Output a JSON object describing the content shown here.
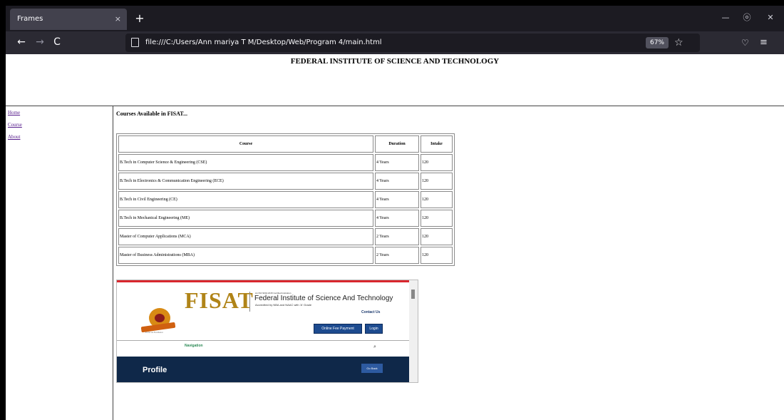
{
  "browser": {
    "tab_title": "Frames",
    "tab_close": "×",
    "new_tab": "+",
    "back": "←",
    "forward": "→",
    "reload": "C",
    "url": "file:///C:/Users/Ann mariya T M/Desktop/Web/Program 4/main.html",
    "zoom": "67%",
    "bookmark_star": "☆",
    "pocket": "♡",
    "menu": "≡",
    "minimize": "—",
    "restore": "ⓞ",
    "close": "✕"
  },
  "header": {
    "title": "FEDERAL INSTITUTE OF SCIENCE AND TECHNOLOGY"
  },
  "sidebar": {
    "links": [
      "Home",
      "Course",
      "About"
    ]
  },
  "main": {
    "heading": "Courses Available in FISAT...",
    "table": {
      "headers": [
        "Course",
        "Duration",
        "Intake"
      ],
      "rows": [
        [
          "B.Tech in Computer Science & Engineering (CSE)",
          "4 Years",
          "120"
        ],
        [
          "B.Tech in Electronics & Communication Engineering (ECE)",
          "4 Years",
          "120"
        ],
        [
          "B.Tech in Civil Engineering (CE)",
          "4 Years",
          "120"
        ],
        [
          "B.Tech in Mechanical Engineering (ME)",
          "4 Years",
          "120"
        ],
        [
          "Master of Computer Applications (MCA)",
          "2 Years",
          "120"
        ],
        [
          "Master of Business Administrations (MBA)",
          "2 Years",
          "120"
        ]
      ]
    }
  },
  "embedded_site": {
    "brand": "FISAT",
    "iso": "An ISO 9001:2015 Certified Institution",
    "institute_name": "Federal Institute of Science And Technology",
    "accreditation": "Accredited by NBA and NAAC with 'A' Grade",
    "logo_tagline": "Focus on Excellence",
    "contact": "Contact Us",
    "fee_button": "Online Fee Payment",
    "login_button": "Login",
    "navigation": "Navigation",
    "search_icon": "⌕",
    "profile": "Profile",
    "go_back": "Go Back"
  },
  "colors": {
    "accent_red": "#d9272e",
    "brand_gold": "#b08418",
    "navy": "#0f2849",
    "link_visited": "#551a8b"
  }
}
